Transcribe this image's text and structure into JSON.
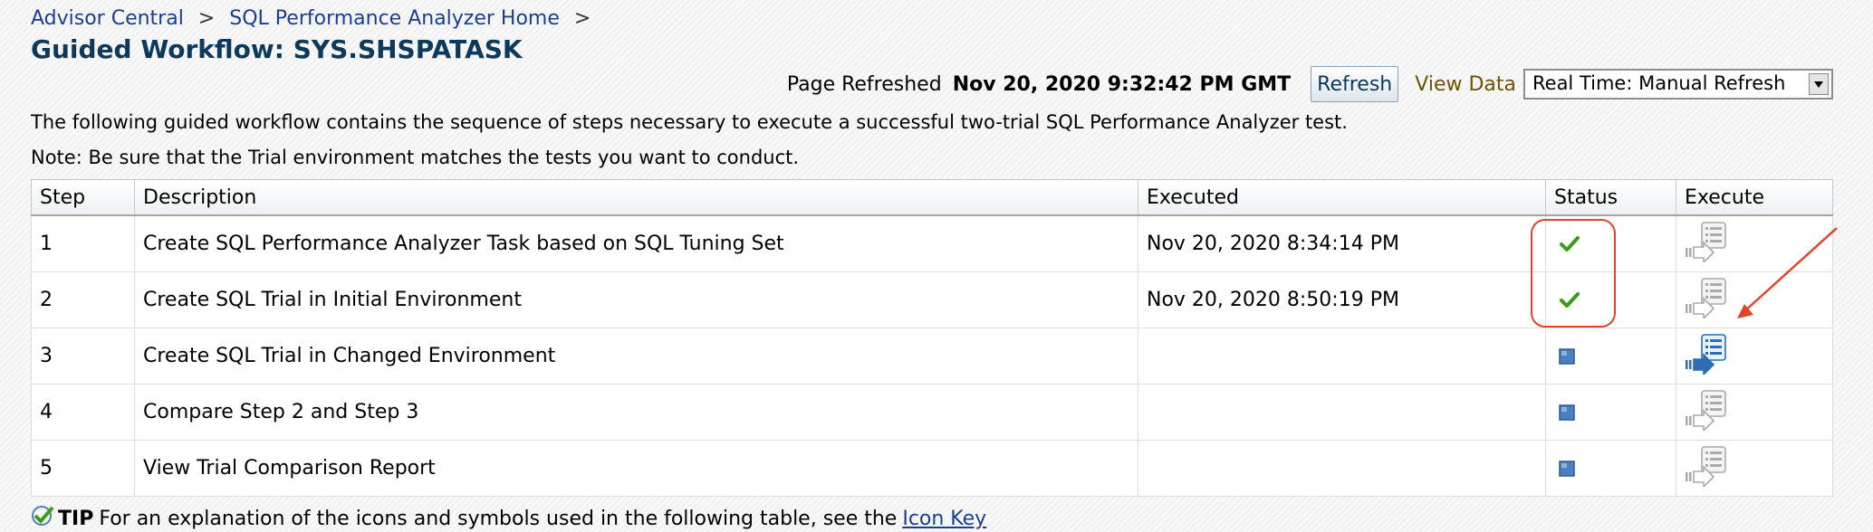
{
  "breadcrumb": {
    "items": [
      {
        "label": "Advisor Central"
      },
      {
        "label": "SQL Performance Analyzer Home"
      }
    ],
    "separator": ">"
  },
  "page_title": "Guided Workflow: SYS.SHSPATASK",
  "refresh_bar": {
    "page_refreshed_label": "Page Refreshed",
    "timestamp": "Nov 20, 2020 9:32:42 PM GMT",
    "refresh_button_label": "Refresh",
    "view_data_label": "View Data",
    "view_data_selected": "Real Time: Manual Refresh"
  },
  "intro_text": "The following guided workflow contains the sequence of steps necessary to execute a successful two-trial SQL Performance Analyzer test.",
  "note_text": "Note: Be sure that the Trial environment matches the tests you want to conduct.",
  "table": {
    "headers": {
      "step": "Step",
      "description": "Description",
      "executed": "Executed",
      "status": "Status",
      "execute": "Execute"
    },
    "rows": [
      {
        "step": "1",
        "description": "Create SQL Performance Analyzer Task based on SQL Tuning Set",
        "executed": "Nov 20, 2020 8:34:14 PM",
        "status": "completed",
        "status_icon": "check-icon",
        "execute_enabled": false
      },
      {
        "step": "2",
        "description": "Create SQL Trial in Initial Environment",
        "executed": "Nov 20, 2020 8:50:19 PM",
        "status": "completed",
        "status_icon": "check-icon",
        "execute_enabled": false
      },
      {
        "step": "3",
        "description": "Create SQL Trial in Changed Environment",
        "executed": "",
        "status": "not-started",
        "status_icon": "pending-square-icon",
        "execute_enabled": true
      },
      {
        "step": "4",
        "description": "Compare Step 2 and Step 3",
        "executed": "",
        "status": "not-started",
        "status_icon": "pending-square-icon",
        "execute_enabled": false
      },
      {
        "step": "5",
        "description": "View Trial Comparison Report",
        "executed": "",
        "status": "not-started",
        "status_icon": "pending-square-icon",
        "execute_enabled": false
      }
    ]
  },
  "tip": {
    "label": "TIP",
    "text": "For an explanation of the icons and symbols used in the following table, see the",
    "link_label": "Icon Key"
  },
  "colors": {
    "link": "#1a3f8f",
    "title": "#0b3a5c",
    "check": "#3a9b1a",
    "pending": "#4a7fc1",
    "annotation": "#e0452c"
  }
}
